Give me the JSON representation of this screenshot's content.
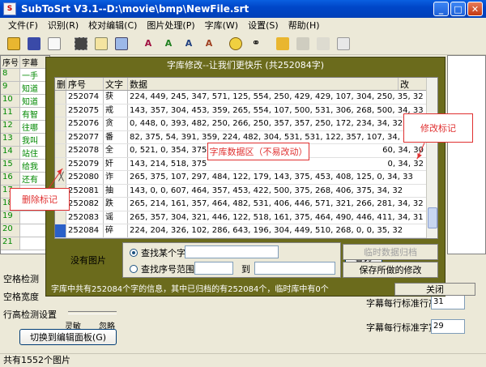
{
  "window": {
    "title": "SubToSrt V3.1--D:\\movie\\bmp\\NewFile.srt"
  },
  "menu": [
    "文件(F)",
    "识别(R)",
    "校对编辑(C)",
    "图片处理(P)",
    "字库(W)",
    "设置(S)",
    "帮助(H)"
  ],
  "main_grid": {
    "headers": [
      "序号",
      "字幕"
    ],
    "rows": [
      {
        "n": "8",
        "t": "一手"
      },
      {
        "n": "9",
        "t": "知道"
      },
      {
        "n": "10",
        "t": "知道"
      },
      {
        "n": "11",
        "t": "有智"
      },
      {
        "n": "12",
        "t": "往哪"
      },
      {
        "n": "13",
        "t": "我叫"
      },
      {
        "n": "14",
        "t": "站住"
      },
      {
        "n": "15",
        "t": "给我"
      },
      {
        "n": "16",
        "t": "还有"
      },
      {
        "n": "17",
        "t": ""
      },
      {
        "n": "18",
        "t": ""
      },
      {
        "n": "19",
        "t": ""
      },
      {
        "n": "20",
        "t": ""
      },
      {
        "n": "21",
        "t": ""
      }
    ]
  },
  "dialog": {
    "title": "字库修改--让我们更快乐 (共252084字)",
    "columns": [
      "删",
      "序号",
      "文字",
      "数据",
      "改"
    ],
    "rows": [
      {
        "del": "",
        "id": "252074",
        "ch": "获",
        "data": "224, 449, 245, 347, 571, 125, 554, 250, 429, 429, 107, 304, 250, 35, 32",
        "mod": ""
      },
      {
        "del": "",
        "id": "252075",
        "ch": "戒",
        "data": "143, 357, 304, 453, 359, 265, 554, 107, 500, 531, 306, 268, 500, 34, 33",
        "mod": ""
      },
      {
        "del": "",
        "id": "252076",
        "ch": "贪",
        "data": "0, 448, 0, 393, 482, 250, 266, 250, 357, 357, 250, 172, 234, 34, 32",
        "mod": ""
      },
      {
        "del": "",
        "id": "252077",
        "ch": "番",
        "data": "82, 375, 54, 391, 359, 224, 482, 304, 531, 531, 122, 357, 107, 34, 33",
        "mod": ""
      },
      {
        "del": "",
        "id": "252078",
        "ch": "全",
        "data": "0, 521, 0, 354, 375, 238",
        "tail": "60, 34, 30",
        "mod": ""
      },
      {
        "del": "",
        "id": "252079",
        "ch": "奸",
        "data": "143, 214, 518, 375",
        "tail": "0, 34, 32",
        "mod": ""
      },
      {
        "del": "╳",
        "id": "252080",
        "ch": "诈",
        "data": "265, 375, 107, 297, 484, 122, 179, 143, 375, 453, 408, 125, 0, 34, 33",
        "mod": "√"
      },
      {
        "del": "",
        "id": "252081",
        "ch": "抽",
        "data": "143, 0, 0, 607, 464, 357, 453, 422, 500, 375, 268, 406, 375, 34, 32",
        "mod": ""
      },
      {
        "del": "",
        "id": "252082",
        "ch": "跌",
        "data": "265, 214, 161, 357, 464, 482, 531, 406, 446, 571, 321, 266, 281, 34, 32",
        "mod": ""
      },
      {
        "del": "",
        "id": "252083",
        "ch": "谣",
        "data": "265, 357, 304, 321, 446, 122, 518, 161, 375, 464, 490, 446, 411, 34, 31",
        "mod": ""
      },
      {
        "del": "",
        "id": "252084",
        "ch": "碎",
        "data": "224, 204, 326, 102, 286, 643, 196, 304, 449, 510, 268, 0, 0, 35, 32",
        "mod": ""
      }
    ],
    "no_image": "没有图片",
    "search": {
      "opt1": "查找某个字",
      "opt2": "查找序号范围",
      "to": "到",
      "find_button": "查找"
    },
    "temp_archive_button": "临时数据归档",
    "save_button": "保存所做的修改",
    "status": "字库中共有252084个字的信息，其中已归档的有252084个，临时库中有0个",
    "close_button": "关闭"
  },
  "annotations": {
    "data_area": "字库数据区（不易改动）",
    "modify_mark": "修改标记",
    "delete_mark": "删除标记"
  },
  "lower": {
    "edge_detect": "空格检测",
    "space_width": "空格宽度",
    "row_height_detect": "行高检测设置",
    "sensitive": "灵敏",
    "ignore": "忽略",
    "switch_button": "切换到编辑面板(G)",
    "std_height_label": "字幕每行标准行高",
    "std_height_value": "31",
    "std_width_label": "字幕每行标准字宽",
    "std_width_value": "29"
  },
  "statusbar": "共有1552个图片"
}
